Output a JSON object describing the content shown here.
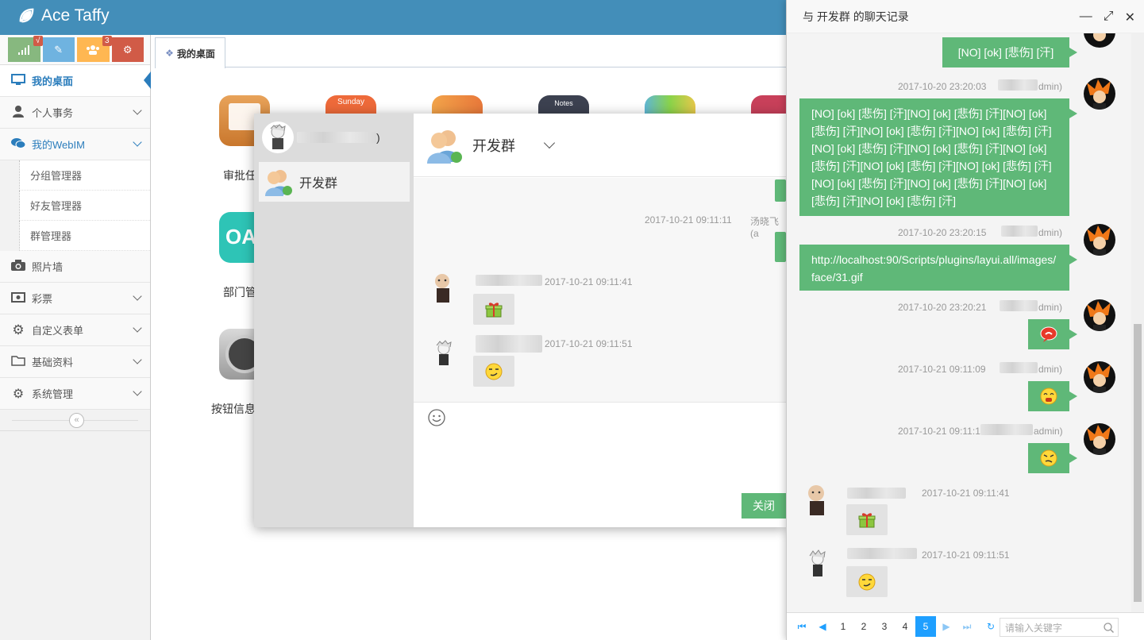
{
  "app": {
    "title": "Ace Taffy"
  },
  "shortcuts": [
    {
      "name": "stats",
      "color": "#87b87f",
      "icon": "signal-icon",
      "badge": "√"
    },
    {
      "name": "edit",
      "color": "#6fb3e0",
      "icon": "pencil-icon",
      "badge": ""
    },
    {
      "name": "users",
      "color": "#ffb752",
      "icon": "users-icon",
      "badge": "3"
    },
    {
      "name": "settings",
      "color": "#d15b47",
      "icon": "cogs-icon",
      "badge": ""
    }
  ],
  "sidebar": {
    "items": [
      {
        "label": "我的桌面"
      },
      {
        "label": "个人事务"
      },
      {
        "label": "我的WebIM"
      },
      {
        "label": "分组管理器"
      },
      {
        "label": "好友管理器"
      },
      {
        "label": "群管理器"
      },
      {
        "label": "照片墙"
      },
      {
        "label": "彩票"
      },
      {
        "label": "自定义表单"
      },
      {
        "label": "基础资料"
      },
      {
        "label": "系统管理"
      }
    ],
    "collapse_icon": "«"
  },
  "tabs": [
    {
      "label": "我的桌面"
    }
  ],
  "desktop": {
    "calendar_day": "Sunday",
    "notes_label": "Notes",
    "oa_label": "OA",
    "labels": [
      "审批任",
      "部门管",
      "按钮信息"
    ]
  },
  "chat": {
    "me_suffix": ")",
    "group_name": "开发群",
    "header_title": "开发群",
    "messages": [
      {
        "time": "2017-10-21 09:11:11",
        "user": "汤晓飞(a"
      },
      {
        "time": "2017-10-21 09:11:41"
      },
      {
        "time": "2017-10-21 09:11:51"
      }
    ],
    "close_label": "关闭"
  },
  "history": {
    "title": "与 开发群 的聊天记录",
    "entries": [
      {
        "time": "",
        "user": "",
        "text": "[NO] [ok] [悲伤] [汗]"
      },
      {
        "time": "2017-10-20 23:20:03",
        "user": "dmin)",
        "text": "[NO] [ok] [悲伤] [汗][NO] [ok] [悲伤] [汗][NO] [ok] [悲伤] [汗][NO] [ok] [悲伤] [汗][NO] [ok] [悲伤] [汗][NO] [ok] [悲伤] [汗][NO] [ok] [悲伤] [汗][NO] [ok] [悲伤] [汗][NO] [ok] [悲伤] [汗][NO] [ok] [悲伤] [汗][NO] [ok] [悲伤] [汗][NO] [ok] [悲伤] [汗][NO] [ok] [悲伤] [汗][NO] [ok] [悲伤] [汗]"
      },
      {
        "time": "2017-10-20 23:20:15",
        "user": "dmin)",
        "text": "http://localhost:90/Scripts/plugins/layui.all/images/face/31.gif"
      },
      {
        "time": "2017-10-20 23:20:21",
        "user": "dmin)",
        "text": ""
      },
      {
        "time": "2017-10-21 09:11:09",
        "user": "dmin)",
        "text": ""
      },
      {
        "time": "2017-10-21 09:11:1",
        "user": "admin)",
        "text": ""
      },
      {
        "time": "2017-10-21 09:11:41",
        "user": "",
        "text": ""
      },
      {
        "time": "2017-10-21 09:11:51",
        "user": "",
        "text": ""
      }
    ]
  },
  "pager": {
    "pages": [
      "1",
      "2",
      "3",
      "4",
      "5"
    ],
    "current": "5",
    "search_placeholder": "请输入关键字"
  },
  "colors": {
    "header": "#438eb9",
    "bubble": "#5fb878",
    "pager_active": "#1e9fff"
  }
}
